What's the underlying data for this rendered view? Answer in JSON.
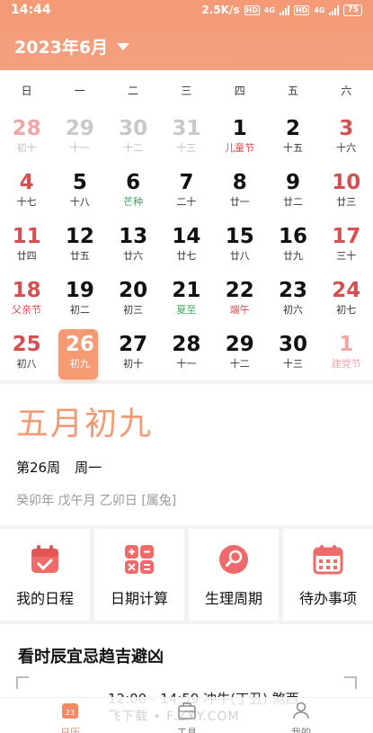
{
  "status": {
    "time": "14:44",
    "speed": "2.5K/s",
    "hd1": "HD",
    "net1": "4G",
    "hd2": "HD",
    "net2": "4G",
    "battery": "75"
  },
  "header": {
    "month_title": "2023年6月",
    "caret_icon": "chevron-down-icon"
  },
  "weekdays": [
    "日",
    "一",
    "二",
    "三",
    "四",
    "五",
    "六"
  ],
  "calendar": {
    "weeks": [
      [
        {
          "day": "28",
          "sub": "初十",
          "dim": true,
          "weekend": true
        },
        {
          "day": "29",
          "sub": "十一",
          "dim": true
        },
        {
          "day": "30",
          "sub": "十二",
          "dim": true
        },
        {
          "day": "31",
          "sub": "十三",
          "dim": true
        },
        {
          "day": "1",
          "sub": "儿童节",
          "subtype": "fest"
        },
        {
          "day": "2",
          "sub": "十五"
        },
        {
          "day": "3",
          "sub": "十六",
          "weekend": true
        }
      ],
      [
        {
          "day": "4",
          "sub": "十七",
          "weekend": true
        },
        {
          "day": "5",
          "sub": "十八"
        },
        {
          "day": "6",
          "sub": "芒种",
          "subtype": "term"
        },
        {
          "day": "7",
          "sub": "二十"
        },
        {
          "day": "8",
          "sub": "廿一"
        },
        {
          "day": "9",
          "sub": "廿二"
        },
        {
          "day": "10",
          "sub": "廿三",
          "weekend": true
        }
      ],
      [
        {
          "day": "11",
          "sub": "廿四",
          "weekend": true
        },
        {
          "day": "12",
          "sub": "廿五"
        },
        {
          "day": "13",
          "sub": "廿六"
        },
        {
          "day": "14",
          "sub": "廿七"
        },
        {
          "day": "15",
          "sub": "廿八"
        },
        {
          "day": "16",
          "sub": "廿九"
        },
        {
          "day": "17",
          "sub": "三十",
          "weekend": true
        }
      ],
      [
        {
          "day": "18",
          "sub": "父亲节",
          "subtype": "fest",
          "weekend": true
        },
        {
          "day": "19",
          "sub": "初二"
        },
        {
          "day": "20",
          "sub": "初三"
        },
        {
          "day": "21",
          "sub": "夏至",
          "subtype": "term"
        },
        {
          "day": "22",
          "sub": "端午",
          "subtype": "fest"
        },
        {
          "day": "23",
          "sub": "初六"
        },
        {
          "day": "24",
          "sub": "初七",
          "weekend": true
        }
      ],
      [
        {
          "day": "25",
          "sub": "初八",
          "weekend": true
        },
        {
          "day": "26",
          "sub": "初九",
          "selected": true
        },
        {
          "day": "27",
          "sub": "初十"
        },
        {
          "day": "28",
          "sub": "十一"
        },
        {
          "day": "29",
          "sub": "十二"
        },
        {
          "day": "30",
          "sub": "十三"
        },
        {
          "day": "1",
          "sub": "建党节",
          "subtype": "fest",
          "dim": true,
          "weekend": true
        }
      ]
    ]
  },
  "info": {
    "lunar_date": "五月初九",
    "week_no": "第26周",
    "weekday": "周一",
    "ganzhi": "癸卯年 戊午月 乙卯日 [属兔]"
  },
  "tools": [
    {
      "label": "我的日程",
      "icon": "schedule-calendar-icon"
    },
    {
      "label": "日期计算",
      "icon": "calculator-icon"
    },
    {
      "label": "生理周期",
      "icon": "cycle-search-icon"
    },
    {
      "label": "待办事项",
      "icon": "todo-calendar-icon"
    }
  ],
  "almanac": {
    "title": "看时辰宜忌趋吉避凶",
    "partial_row": "12:00 - 14:59  冲牛(丁丑) 煞西"
  },
  "bottom_nav": {
    "items": [
      {
        "label": "日历",
        "icon": "calendar-icon",
        "badge": "23"
      },
      {
        "label": "工具",
        "icon": "toolbox-icon"
      },
      {
        "label": "我的",
        "icon": "user-icon"
      }
    ],
    "watermark": "飞下载 • F.ZXY.COM"
  },
  "colors": {
    "accent": "#f49a76",
    "festival": "#d44f4f",
    "solar_term": "#3aa35a",
    "lunar_big": "#f19a73"
  }
}
